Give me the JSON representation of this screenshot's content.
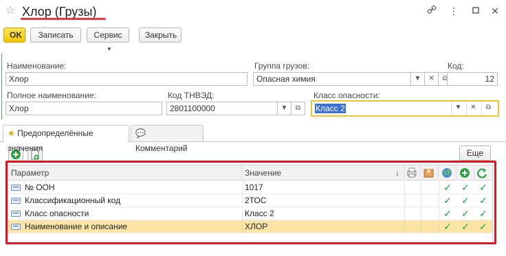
{
  "window": {
    "title": "Хлор (Грузы)",
    "controls": [
      "link-icon",
      "more-icon",
      "maximize-icon",
      "close-icon"
    ]
  },
  "toolbar": {
    "ok_label": "OK",
    "save_label": "Записать",
    "service_label": "Сервис",
    "close_label": "Закрыть"
  },
  "form": {
    "name_label": "Наименование:",
    "name_value": "Хлор",
    "group_label": "Группа грузов:",
    "group_value": "Опасная химия",
    "code_label": "Код:",
    "code_value": "12",
    "fullname_label": "Полное наименование:",
    "fullname_value": "Хлор",
    "tnved_label": "Код ТНВЭД:",
    "tnved_value": "2801100000",
    "hazard_label": "Класс опасности:",
    "hazard_value": "Класс 2"
  },
  "tabs": [
    {
      "label": "Предопределённые значения",
      "icon": "star-icon",
      "active": true
    },
    {
      "label": "Комментарий",
      "icon": "comment-icon",
      "active": false
    }
  ],
  "table_toolbar": {
    "more_label": "Еще"
  },
  "table": {
    "columns": {
      "param": "Параметр",
      "value": "Значение"
    },
    "column_icons": [
      "sort-down-icon",
      "print-icon",
      "package-icon",
      "globe-icon",
      "plus-circle-icon",
      "refresh-icon"
    ],
    "rows": [
      {
        "param": "№ ООН",
        "value": "1017",
        "checks": [
          "✓",
          "✓",
          "✓"
        ]
      },
      {
        "param": "Классификационный код",
        "value": "2ТОС",
        "checks": [
          "✓",
          "✓",
          "✓"
        ]
      },
      {
        "param": "Класс опасности",
        "value": "Класс 2",
        "checks": [
          "✓",
          "✓",
          "✓"
        ]
      },
      {
        "param": "Наименование и описание",
        "value": "ХЛОР",
        "checks": [
          "✓",
          "✓",
          "✓"
        ]
      }
    ]
  },
  "colors": {
    "ok_button": "#f4c500",
    "highlight_border": "#e0141e",
    "selected_row": "#fbe4a6",
    "check": "#1a9a3a",
    "focus_border": "#f1c232"
  }
}
